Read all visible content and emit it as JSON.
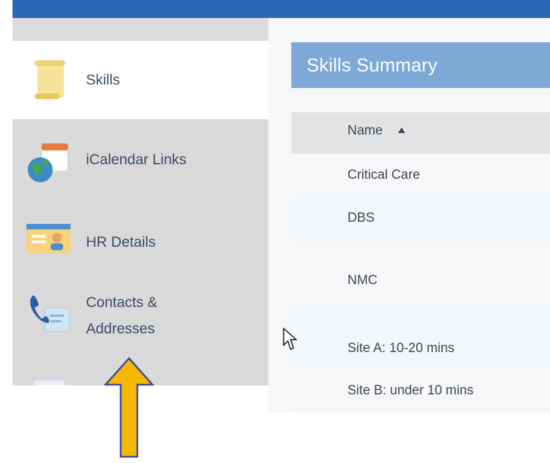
{
  "sidebar": {
    "items": [
      {
        "label": "Skills",
        "icon": "scroll-icon",
        "active": true
      },
      {
        "label": "iCalendar Links",
        "icon": "calendar-globe-icon",
        "active": false
      },
      {
        "label": "HR Details",
        "icon": "id-card-icon",
        "active": false
      },
      {
        "label": "Contacts &",
        "label2": "Addresses",
        "icon": "phone-contact-icon",
        "active": false
      }
    ]
  },
  "main": {
    "header": "Skills Summary",
    "table": {
      "column_name": "Name",
      "sort_indicator": "ascending",
      "rows": [
        "Critical Care",
        "DBS",
        "NMC",
        "Site A: 10-20 mins",
        "Site B: under 10 mins"
      ]
    }
  },
  "colors": {
    "top_band": "#2b67b8",
    "header_bg": "#7ea9d6",
    "sidebar_bg": "#d9d9d9",
    "arrow_fill": "#f5b800",
    "arrow_stroke": "#3b4a9a"
  }
}
